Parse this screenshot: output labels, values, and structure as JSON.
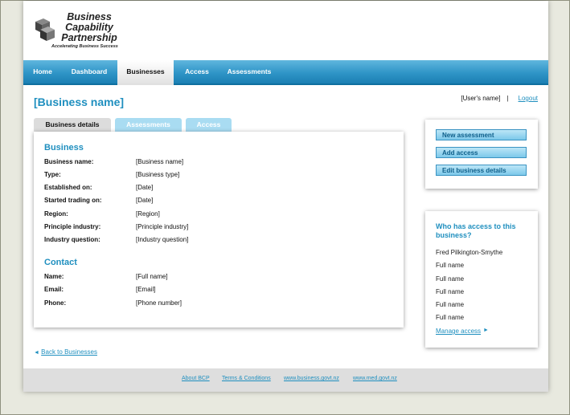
{
  "logo": {
    "line1": "Business",
    "line2": "Capability",
    "line3": "Partnership",
    "tagline": "Accelerating Business Success"
  },
  "nav": {
    "items": [
      {
        "label": "Home",
        "active": false
      },
      {
        "label": "Dashboard",
        "active": false
      },
      {
        "label": "Businesses",
        "active": true
      },
      {
        "label": "Access",
        "active": false
      },
      {
        "label": "Assessments",
        "active": false
      }
    ]
  },
  "header": {
    "title": "[Business name]",
    "user_name": "[User's name]",
    "separator": "|",
    "logout_label": "Logout"
  },
  "tabs": [
    {
      "label": "Business details",
      "active": true
    },
    {
      "label": "Assessments",
      "active": false
    },
    {
      "label": "Access",
      "active": false
    }
  ],
  "business": {
    "section_title": "Business",
    "fields": [
      {
        "label": "Business name:",
        "value": "[Business name]"
      },
      {
        "label": "Type:",
        "value": "[Business type]"
      },
      {
        "label": "Established on:",
        "value": "[Date]"
      },
      {
        "label": "Started trading on:",
        "value": "[Date]"
      },
      {
        "label": "Region:",
        "value": "[Region]"
      },
      {
        "label": "Principle industry:",
        "value": "[Principle industry]"
      },
      {
        "label": "Industry question:",
        "value": "[Industry question]"
      }
    ]
  },
  "contact": {
    "section_title": "Contact",
    "fields": [
      {
        "label": "Name:",
        "value": "[Full name]"
      },
      {
        "label": "Email:",
        "value": "[Email]"
      },
      {
        "label": "Phone:",
        "value": "[Phone number]"
      }
    ]
  },
  "actions": {
    "new_assessment": "New assessment",
    "add_access": "Add access",
    "edit_details": "Edit business details"
  },
  "access_list": {
    "title": "Who has access to this business?",
    "people": [
      "Fred Pilkington-Smythe",
      "Full name",
      "Full name",
      "Full name",
      "Full name",
      "Full name"
    ],
    "manage_label": "Manage access",
    "manage_arrow": "►"
  },
  "back": {
    "arrow": "◄",
    "label": "Back to Businesses"
  },
  "footer": {
    "links": [
      "About BCP",
      "Terms & Conditions",
      "www.business.govt.nz",
      "www.med.govt.nz"
    ]
  },
  "colors": {
    "accent": "#1f8fbf",
    "nav_blue": "#2f95c7",
    "button_blue": "#7cc8ea",
    "tab_inactive": "#a9dcf2"
  }
}
